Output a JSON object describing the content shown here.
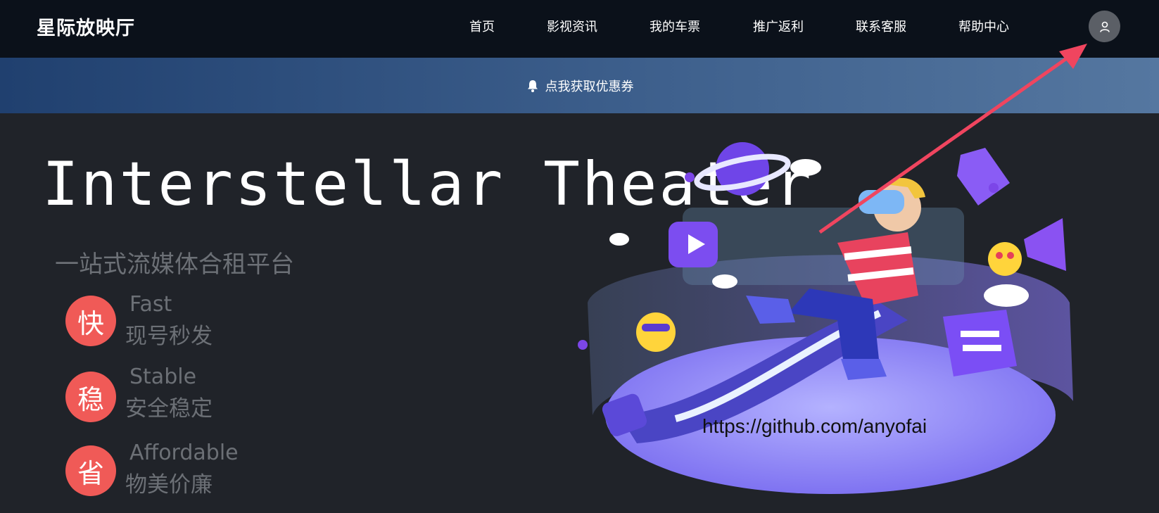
{
  "header": {
    "brand": "星际放映厅",
    "nav": [
      {
        "label": "首页"
      },
      {
        "label": "影视资讯"
      },
      {
        "label": "我的车票"
      },
      {
        "label": "推广返利"
      },
      {
        "label": "联系客服"
      },
      {
        "label": "帮助中心"
      }
    ],
    "avatar_icon": "user-icon"
  },
  "banner": {
    "icon": "bell-icon",
    "text": "点我获取优惠券"
  },
  "hero": {
    "title": "Interstellar Theater",
    "subtitle": "一站式流媒体合租平台",
    "features": [
      {
        "badge": "快",
        "en": "Fast",
        "cn": "现号秒发"
      },
      {
        "badge": "稳",
        "en": "Stable",
        "cn": "安全稳定"
      },
      {
        "badge": "省",
        "en": "Affordable",
        "cn": "物美价廉"
      }
    ],
    "badge_color": "#f05a57"
  },
  "illustration": {
    "watermark": "https://github.com/anyofai"
  },
  "annotation": {
    "arrow_color": "#f0455f"
  }
}
